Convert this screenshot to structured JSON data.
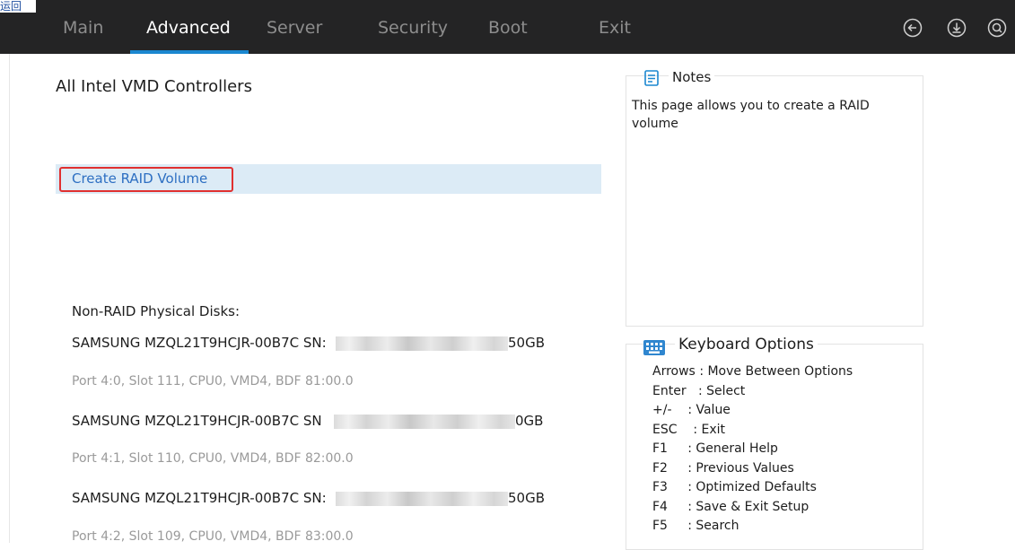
{
  "top_glyph": "运回",
  "tabs": [
    {
      "label": "Main",
      "active": false
    },
    {
      "label": "Advanced",
      "active": true
    },
    {
      "label": "Server",
      "active": false
    },
    {
      "label": "Security",
      "active": false
    },
    {
      "label": "Boot",
      "active": false
    },
    {
      "label": "Exit",
      "active": false
    }
  ],
  "top_icons": [
    "back-arrow-icon",
    "download-icon",
    "search-icon"
  ],
  "page": {
    "title": "All Intel VMD Controllers",
    "create_raid_label": "Create RAID Volume",
    "non_raid_label": "Non-RAID Physical Disks:"
  },
  "disks": [
    {
      "name": "SAMSUNG MZQL21T9HCJR-00B7C SN:",
      "size_suffix": "50GB",
      "port": "Port 4:0, Slot 111, CPU0, VMD4, BDF 81:00.0"
    },
    {
      "name": "SAMSUNG MZQL21T9HCJR-00B7C SN",
      "size_suffix": "0GB",
      "port": "Port 4:1, Slot 110, CPU0, VMD4, BDF 82:00.0"
    },
    {
      "name": "SAMSUNG MZQL21T9HCJR-00B7C SN:",
      "size_suffix": "50GB",
      "port": "Port 4:2, Slot 109, CPU0, VMD4, BDF 83:00.0"
    }
  ],
  "notes": {
    "title": "Notes",
    "text": "This page allows you to create a RAID volume"
  },
  "keyboard": {
    "title": "Keyboard Options",
    "rows": [
      {
        "key": "Arrows",
        "desc": ": Move Between Options"
      },
      {
        "key": "Enter",
        "desc": ": Select"
      },
      {
        "key": "+/-",
        "desc": ": Value"
      },
      {
        "key": "ESC",
        "desc": ": Exit"
      },
      {
        "key": "F1",
        "desc": ": General Help"
      },
      {
        "key": "F2",
        "desc": ": Previous Values"
      },
      {
        "key": "F3",
        "desc": ": Optimized Defaults"
      },
      {
        "key": "F4",
        "desc": ": Save & Exit Setup"
      },
      {
        "key": "F5",
        "desc": ": Search"
      }
    ]
  },
  "colors": {
    "topbar_bg": "#242425",
    "accent": "#1a87d0",
    "selected_row_bg": "#dcebf6",
    "highlight_border": "#e03030",
    "link_text": "#2d6fc2"
  }
}
